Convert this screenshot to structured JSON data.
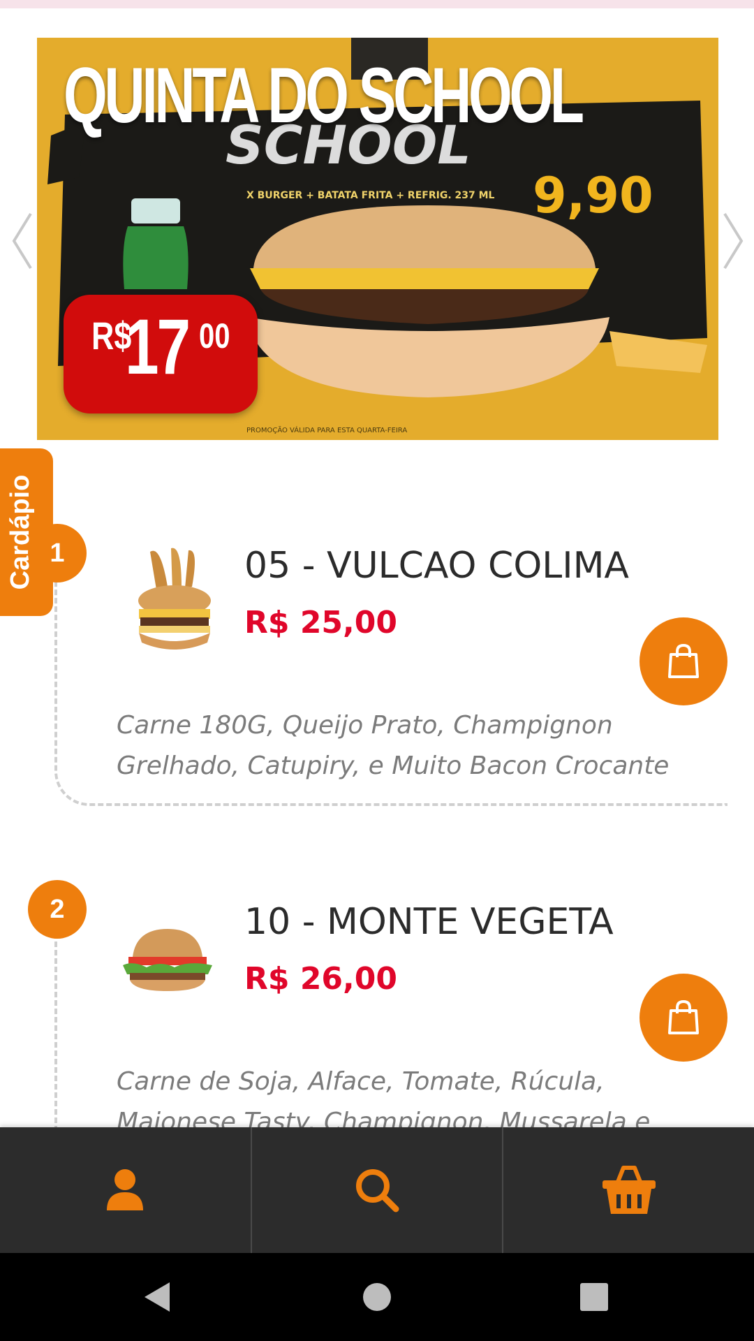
{
  "banner": {
    "title": "QUINTA DO SCHOOL",
    "price_currency": "R$",
    "price_integer": "17",
    "price_cents": "00"
  },
  "menu_tab": {
    "label": "Cardápio"
  },
  "items": [
    {
      "number": "1",
      "name": "05 - VULCAO COLIMA",
      "price": "R$ 25,00",
      "description": "Carne 180G, Queijo Prato, Champignon Grelhado, Catupiry, e Muito Bacon Crocante"
    },
    {
      "number": "2",
      "name": "10 - MONTE VEGETA",
      "price": "R$ 26,00",
      "description": "Carne de Soja, Alface, Tomate, Rúcula, Maionese Tasty, Champignon, Mussarela e Picles"
    }
  ],
  "bottom_nav": [
    "user-icon",
    "search-icon",
    "basket-icon"
  ],
  "colors": {
    "accent": "#ee7e0d",
    "price": "#e0062a",
    "nav_bg": "#2c2c2c"
  }
}
